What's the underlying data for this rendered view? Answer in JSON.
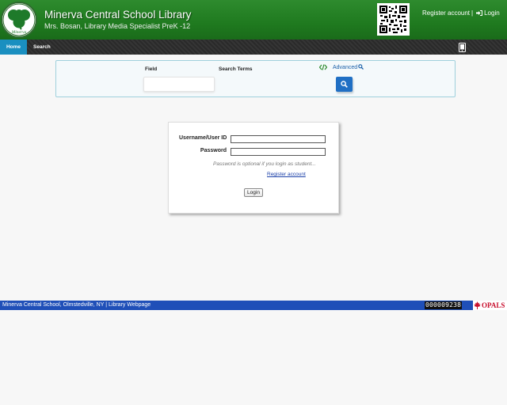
{
  "header": {
    "logo_text": "Minerva",
    "title": "Minerva Central School Library",
    "subtitle": "Mrs. Bosan, Library Media Specialist PreK -12",
    "register_link": "Register account",
    "separator": "|",
    "login_link": "Login"
  },
  "nav": {
    "tabs": [
      {
        "label": "Home",
        "active": true
      },
      {
        "label": "Search",
        "active": false
      }
    ]
  },
  "search": {
    "field_label": "Field",
    "terms_label": "Search Terms",
    "advanced_label": "Advanced"
  },
  "login": {
    "username_label": "Username/User ID",
    "password_label": "Password",
    "username_value": "",
    "password_value": "",
    "hint": "Password is optional if you login as student...",
    "register_link": "Register account",
    "login_button": "Login"
  },
  "footer": {
    "school": "Minerva Central School, Olmstedville, NY",
    "separator": "|",
    "webpage_link": "Library Webpage",
    "counter": "000009238",
    "brand": "OPALS"
  },
  "colors": {
    "header_green": "#1f7a1f",
    "nav_active": "#1a8fc0",
    "footer_blue": "#1f4fb8",
    "search_button": "#1f6fc4",
    "opals_red": "#c8102e"
  }
}
